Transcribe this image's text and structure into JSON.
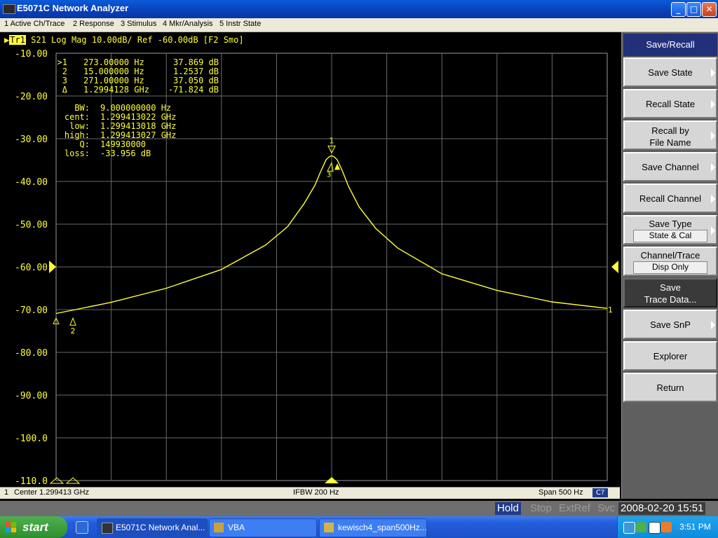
{
  "window": {
    "title": "E5071C Network Analyzer",
    "buttons": {
      "minimize": "_",
      "maximize": "□",
      "close": "✕"
    }
  },
  "menu": [
    "1 Active Ch/Trace",
    "2 Response",
    "3 Stimulus",
    "4 Mkr/Analysis",
    "5 Instr State"
  ],
  "trace_header": {
    "badge": "Tr1",
    "text": "S21 Log Mag 10.00dB/ Ref -60.00dB [F2 Smo]"
  },
  "markers_table": [
    {
      "id": ">1",
      "x": "273.00000 Hz",
      "y": "37.869 dB"
    },
    {
      "id": "2",
      "x": "15.000000 Hz",
      "y": "1.2537 dB"
    },
    {
      "id": "3",
      "x": "271.00000 Hz",
      "y": "37.050 dB"
    },
    {
      "id": "Δ",
      "x": "1.2994128 GHz",
      "y": "-71.824 dB"
    }
  ],
  "filter_stats": [
    {
      "label": "BW:",
      "value": "9.000000000 Hz"
    },
    {
      "label": "cent:",
      "value": "1.299413022 GHz"
    },
    {
      "label": "low:",
      "value": "1.299413018 GHz"
    },
    {
      "label": "high:",
      "value": "1.299413027 GHz"
    },
    {
      "label": "Q:",
      "value": "149930000"
    },
    {
      "label": "loss:",
      "value": "-33.956 dB"
    }
  ],
  "chart_data": {
    "type": "line",
    "ylim": [
      -110,
      -10
    ],
    "y_ticks": [
      "-10.00",
      "-20.00",
      "-30.00",
      "-40.00",
      "-50.00",
      "-60.00",
      "-70.00",
      "-80.00",
      "-90.00",
      "-100.0",
      "-110.0"
    ],
    "x_divisions": 10,
    "grid": true,
    "reference_level": -60,
    "x": [
      -250,
      -200,
      -150,
      -100,
      -60,
      -40,
      -25,
      -15,
      -10,
      -5,
      -2,
      0,
      2,
      5,
      10,
      15,
      25,
      40,
      60,
      100,
      150,
      200,
      250
    ],
    "series": [
      {
        "values": [
          -70.9,
          -68.3,
          -65.0,
          -60.6,
          -54.9,
          -50.6,
          -45.2,
          -40.8,
          -37.7,
          -34.9,
          -34.2,
          -34.0,
          -34.2,
          -34.9,
          -37.7,
          -41.0,
          -46.0,
          -51.0,
          -55.6,
          -61.6,
          -65.5,
          -68.2,
          -69.7
        ]
      }
    ],
    "marker_labels": [
      "1",
      "2",
      "3"
    ],
    "trace_end_label": "1"
  },
  "status": {
    "channel": "1",
    "center": "Center 1.299413 GHz",
    "ifbw": "IFBW 200 Hz",
    "span": "Span 500 Hz",
    "cal": "C?"
  },
  "instr_state": {
    "hold": "Hold",
    "stop": "Stop",
    "extref": "ExtRef",
    "svc": "Svc",
    "datetime": "2008-02-20 15:51"
  },
  "softkeys": {
    "title": "Save/Recall",
    "save_state": "Save State",
    "recall_state": "Recall State",
    "recall_by_file_1": "Recall by",
    "recall_by_file_2": "File Name",
    "save_channel": "Save Channel",
    "recall_channel": "Recall Channel",
    "save_type": "Save Type",
    "save_type_value": "State & Cal",
    "channel_trace": "Channel/Trace",
    "channel_trace_value": "Disp Only",
    "save_trace_1": "Save",
    "save_trace_2": "Trace Data...",
    "save_snp": "Save SnP",
    "explorer": "Explorer",
    "return": "Return"
  },
  "taskbar": {
    "start": "start",
    "tasks": [
      "E5071C Network Anal...",
      "VBA",
      "kewisch4_span500Hz..."
    ],
    "clock": "3:51 PM"
  }
}
